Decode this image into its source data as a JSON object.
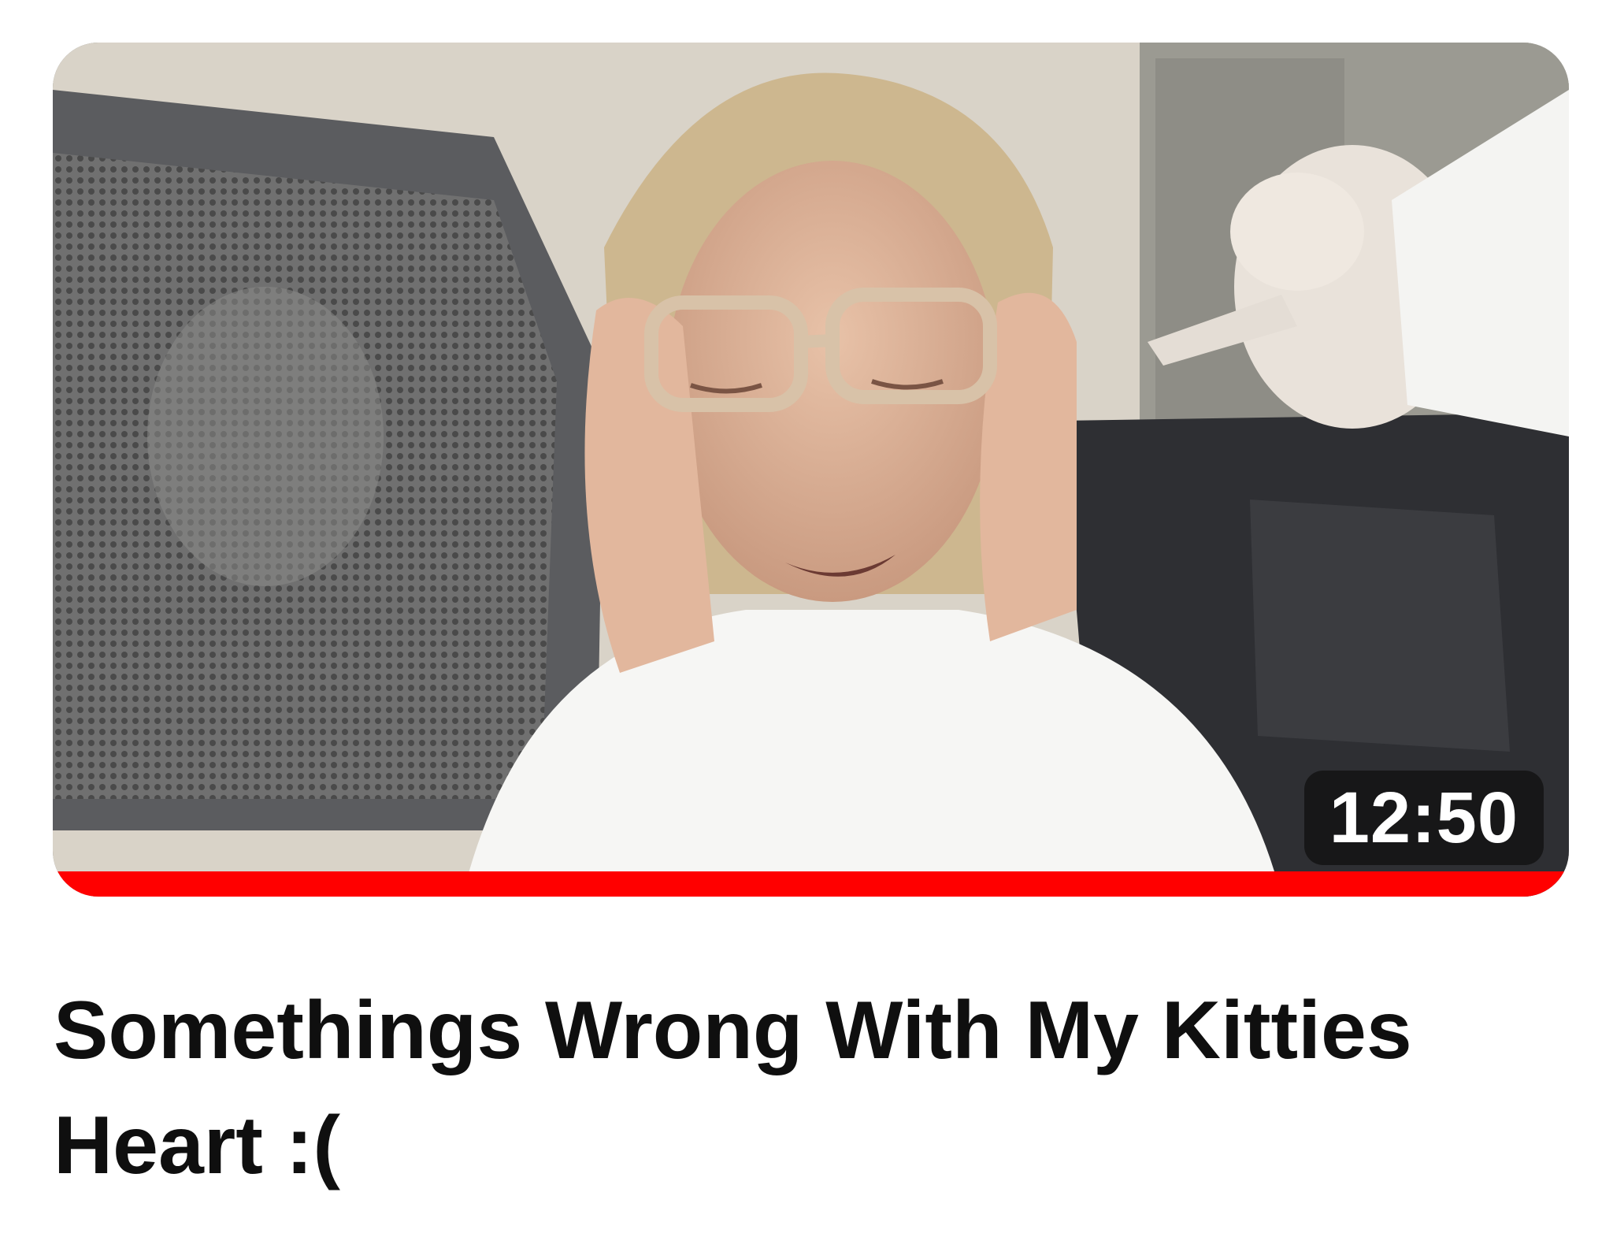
{
  "video": {
    "title": "Somethings Wrong With My Kitties Heart :(",
    "duration": "12:50",
    "progress_fraction": 1.0,
    "thumbnail_alt": "video thumbnail"
  },
  "colors": {
    "progress": "#ff0000",
    "badge_bg": "#141414",
    "title_text": "#0f0f0f"
  }
}
